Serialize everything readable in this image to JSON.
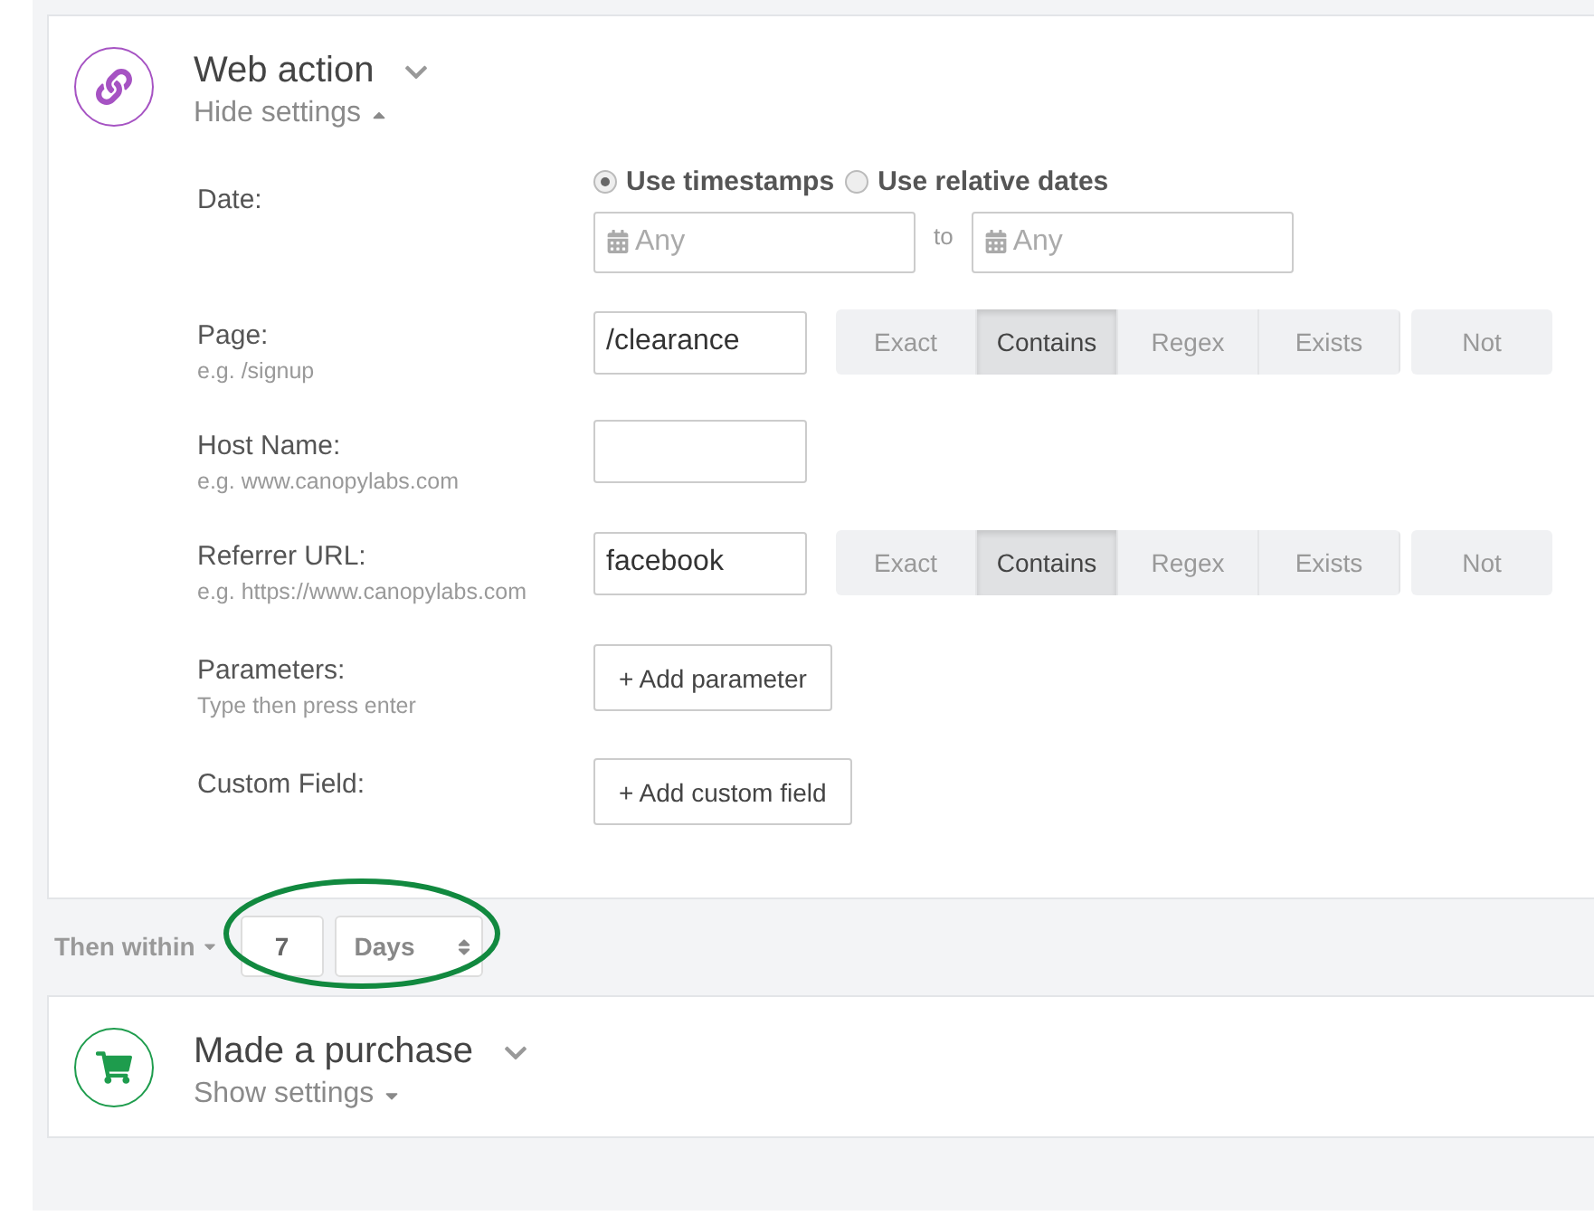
{
  "steps": [
    {
      "kind": "web",
      "title": "Web action",
      "toggle": "Hide settings",
      "expanded": true,
      "color": "#a653c3",
      "fields": [
        {
          "kind": "date",
          "label": "Date:",
          "options": [
            {
              "label": "Use timestamps",
              "selected": true
            },
            {
              "label": "Use relative dates",
              "selected": false
            }
          ],
          "from": {
            "placeholder": "Any"
          },
          "separator": "to",
          "to": {
            "placeholder": "Any"
          }
        },
        {
          "kind": "match",
          "label": "Page:",
          "hint": "e.g. /signup",
          "value": "/clearance",
          "modes": [
            {
              "label": "Exact",
              "selected": false
            },
            {
              "label": "Contains",
              "selected": true
            },
            {
              "label": "Regex",
              "selected": false
            },
            {
              "label": "Exists",
              "selected": false
            }
          ],
          "negate": {
            "label": "Not",
            "selected": false
          }
        },
        {
          "kind": "text",
          "label": "Host Name:",
          "hint": "e.g. www.canopylabs.com"
        },
        {
          "kind": "match",
          "label": "Referrer URL:",
          "hint": "e.g. https://www.canopylabs.com",
          "value": "facebook",
          "modes": [
            {
              "label": "Exact",
              "selected": false
            },
            {
              "label": "Contains",
              "selected": true
            },
            {
              "label": "Regex",
              "selected": false
            },
            {
              "label": "Exists",
              "selected": false
            }
          ],
          "negate": {
            "label": "Not",
            "selected": false
          }
        },
        {
          "kind": "button",
          "label": "Parameters:",
          "hint": "Type then press enter",
          "button": "+ Add parameter"
        },
        {
          "kind": "button",
          "label": "Custom Field:",
          "button": "+ Add custom field"
        }
      ]
    },
    {
      "kind": "delay",
      "label": "Then within",
      "value": "7",
      "unit": "Days",
      "highlighted": true
    },
    {
      "kind": "purchase",
      "title": "Made a purchase",
      "toggle": "Show settings",
      "expanded": false,
      "color": "#1e9c4d"
    }
  ]
}
